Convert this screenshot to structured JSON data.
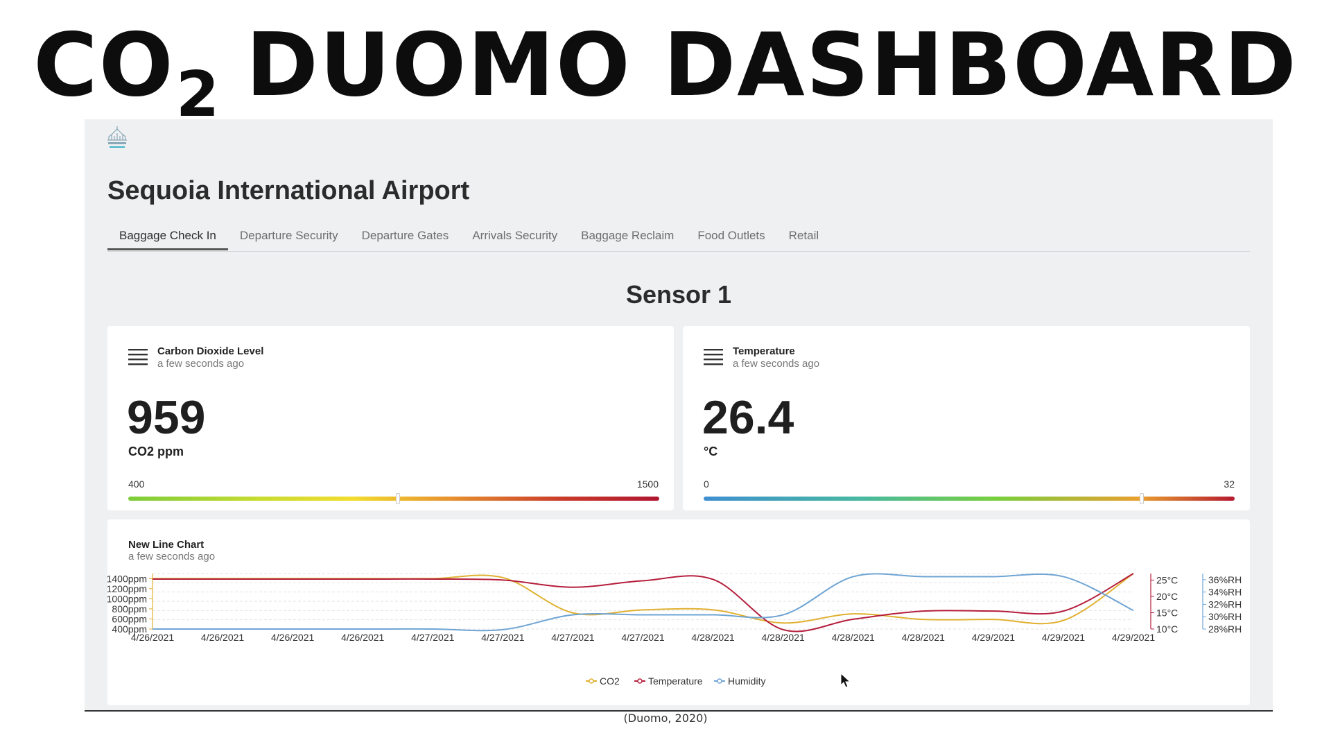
{
  "slide": {
    "title_prefix": "CO",
    "title_subscript": "2",
    "title_rest": "DUOMO DASHBOARD",
    "citation": "(Duomo, 2020)"
  },
  "app": {
    "logo_icon": "duomo-cathedral-icon",
    "venue": "Sequoia International Airport",
    "tabs": [
      {
        "label": "Baggage Check In",
        "active": true
      },
      {
        "label": "Departure Security",
        "active": false
      },
      {
        "label": "Departure Gates",
        "active": false
      },
      {
        "label": "Arrivals Security",
        "active": false
      },
      {
        "label": "Baggage Reclaim",
        "active": false
      },
      {
        "label": "Food Outlets",
        "active": false
      },
      {
        "label": "Retail",
        "active": false
      }
    ],
    "sensor_title": "Sensor 1"
  },
  "cards": {
    "co2": {
      "title": "Carbon Dioxide Level",
      "subtitle": "a few seconds ago",
      "value": "959",
      "unit": "CO2 ppm",
      "min_label": "400",
      "max_label": "1500",
      "min": 400,
      "max": 1500,
      "current": 959
    },
    "temperature": {
      "title": "Temperature",
      "subtitle": "a few seconds ago",
      "value": "26.4",
      "unit": "°C",
      "min_label": "0",
      "max_label": "32",
      "min": 0,
      "max": 32,
      "current": 26.4
    }
  },
  "chart_data": {
    "type": "line",
    "title": "New Line Chart",
    "subtitle": "a few seconds ago",
    "x_labels": [
      "4/26/2021",
      "4/26/2021",
      "4/26/2021",
      "4/26/2021",
      "4/27/2021",
      "4/27/2021",
      "4/27/2021",
      "4/27/2021",
      "4/28/2021",
      "4/28/2021",
      "4/28/2021",
      "4/28/2021",
      "4/29/2021",
      "4/29/2021",
      "4/29/2021"
    ],
    "axes": {
      "co2": {
        "ticks": [
          "400ppm",
          "600ppm",
          "800ppm",
          "1000ppm",
          "1200ppm",
          "1400ppm"
        ],
        "range": [
          400,
          1500
        ],
        "color": "#e0b030"
      },
      "temperature": {
        "ticks": [
          "10°C",
          "15°C",
          "20°C",
          "25°C"
        ],
        "range": [
          10,
          27
        ],
        "color": "#b51e3c"
      },
      "humidity": {
        "ticks": [
          "28%RH",
          "30%RH",
          "32%RH",
          "34%RH",
          "36%RH"
        ],
        "range": [
          28,
          37
        ],
        "color": "#6ea4d4"
      }
    },
    "grid": true,
    "legend": "bottom",
    "series": [
      {
        "name": "CO2",
        "axis": "co2",
        "color": "#e0b030",
        "values": [
          1400,
          1400,
          1400,
          1400,
          1400,
          1420,
          720,
          780,
          780,
          520,
          700,
          590,
          590,
          570,
          1500
        ]
      },
      {
        "name": "Temperature",
        "axis": "temperature",
        "color": "#b51e3c",
        "values": [
          25.3,
          25.3,
          25.3,
          25.3,
          25.3,
          25,
          22.8,
          24.8,
          25.2,
          9.8,
          13,
          15.5,
          15.5,
          15.5,
          27
        ]
      },
      {
        "name": "Humidity",
        "axis": "humidity",
        "color": "#6ea4d4",
        "values": [
          28,
          28,
          28,
          28,
          28,
          27.9,
          30.3,
          30.3,
          30.3,
          30.3,
          36.5,
          36.5,
          36.5,
          36.5,
          31
        ]
      }
    ]
  }
}
